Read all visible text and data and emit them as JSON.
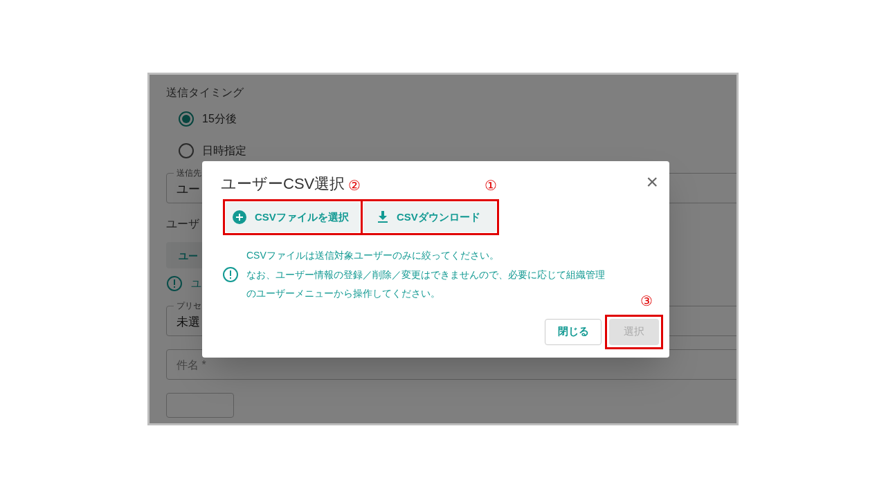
{
  "form": {
    "section_title": "送信タイミング",
    "radios": [
      {
        "label": "15分後",
        "selected": true
      },
      {
        "label": "日時指定",
        "selected": false
      }
    ],
    "recipient_field": {
      "label": "送信先",
      "value": "ユー"
    },
    "user_label": "ユーザ",
    "user_button": "ユー",
    "info_text": "ユ",
    "preset_field": {
      "label": "プリセ",
      "value": "未選"
    },
    "subject_field": {
      "placeholder": "件名 *"
    }
  },
  "dialog": {
    "title": "ユーザーCSV選択",
    "close": "×",
    "actions": [
      {
        "label": "CSVファイルを選択",
        "annotation": "②"
      },
      {
        "label": "CSVダウンロード",
        "annotation": "①"
      }
    ],
    "notice": [
      "CSVファイルは送信対象ユーザーのみに絞ってください。",
      "なお、ユーザー情報の登録／削除／変更はできませんので、必要に応じて組織管理",
      "のユーザーメニューから操作してください。"
    ],
    "footer_buttons": [
      {
        "label": "閉じる",
        "disabled": false
      },
      {
        "label": "選択",
        "disabled": true,
        "annotation": "③"
      }
    ]
  }
}
